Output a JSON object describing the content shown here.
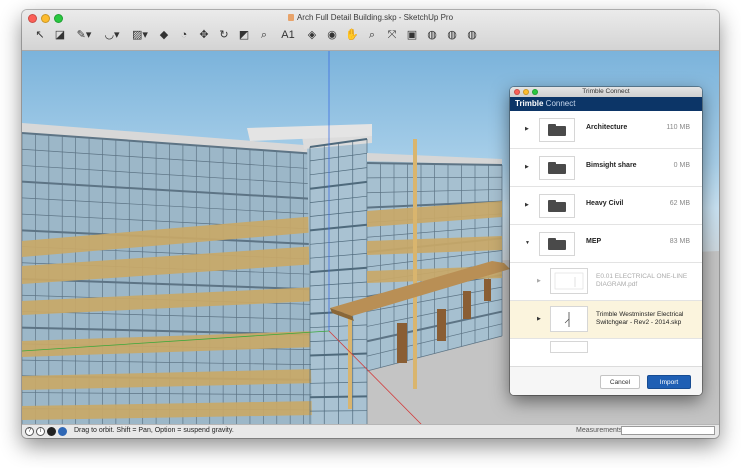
{
  "window": {
    "title": "Arch Full Detail Building.skp - SketchUp Pro"
  },
  "toolbar": {
    "tools": [
      {
        "name": "select-tool",
        "glyph": "↖"
      },
      {
        "name": "eraser-tool",
        "glyph": "◪"
      },
      {
        "name": "line-tool",
        "glyph": "✎▾"
      },
      {
        "name": "arc-tool",
        "glyph": "◡▾"
      },
      {
        "name": "rectangle-tool",
        "glyph": "▨▾"
      },
      {
        "name": "push-pull-tool",
        "glyph": "◆"
      },
      {
        "name": "offset-tool",
        "glyph": "◔"
      },
      {
        "name": "move-tool",
        "glyph": "✥"
      },
      {
        "name": "rotate-tool",
        "glyph": "↻"
      },
      {
        "name": "scale-tool",
        "glyph": "◩"
      },
      {
        "name": "tape-measure-tool",
        "glyph": "⌕"
      },
      {
        "name": "text-tool",
        "glyph": "A1"
      },
      {
        "name": "paint-bucket-tool",
        "glyph": "◈"
      },
      {
        "name": "orbit-tool",
        "glyph": "◉"
      },
      {
        "name": "pan-tool",
        "glyph": "✋"
      },
      {
        "name": "zoom-tool",
        "glyph": "⌕"
      },
      {
        "name": "zoom-extents-tool",
        "glyph": "⤧"
      },
      {
        "name": "warehouse-tool",
        "glyph": "▣"
      },
      {
        "name": "extension-warehouse-tool",
        "glyph": "◍"
      },
      {
        "name": "trimble-connect-tool",
        "glyph": "◍"
      },
      {
        "name": "share-tool",
        "glyph": "◍"
      }
    ]
  },
  "status": {
    "icons": [
      "?",
      "i",
      "user",
      "globe"
    ],
    "text": "Drag to orbit. Shift = Pan, Option = suspend gravity.",
    "measurements_label": "Measurements",
    "measurements_value": ""
  },
  "trimble_connect": {
    "window_title": "Trimble Connect",
    "brand_bold": "Trimble",
    "brand_light": " Connect",
    "folders": [
      {
        "name": "Architecture",
        "size": "110 MB",
        "expanded": false
      },
      {
        "name": "Bimsight share",
        "size": "0 MB",
        "expanded": false
      },
      {
        "name": "Heavy Civil",
        "size": "62 MB",
        "expanded": false
      },
      {
        "name": "MEP",
        "size": "83 MB",
        "expanded": true
      }
    ],
    "files": [
      {
        "name": "E0.01 ELECTRICAL ONE-LINE DIAGRAM.pdf",
        "dim": true,
        "selected": false
      },
      {
        "name": "Trimble Westminster Electrical Switchgear - Rev2 - 2014.skp",
        "dim": false,
        "selected": true
      }
    ],
    "cancel_label": "Cancel",
    "import_label": "Import"
  },
  "colors": {
    "brand": "#0c3567",
    "import_button": "#1f5fb4",
    "selected_row": "#fbf4dd",
    "glass": "#8fb3c9",
    "wood_panel": "#c9a867"
  }
}
